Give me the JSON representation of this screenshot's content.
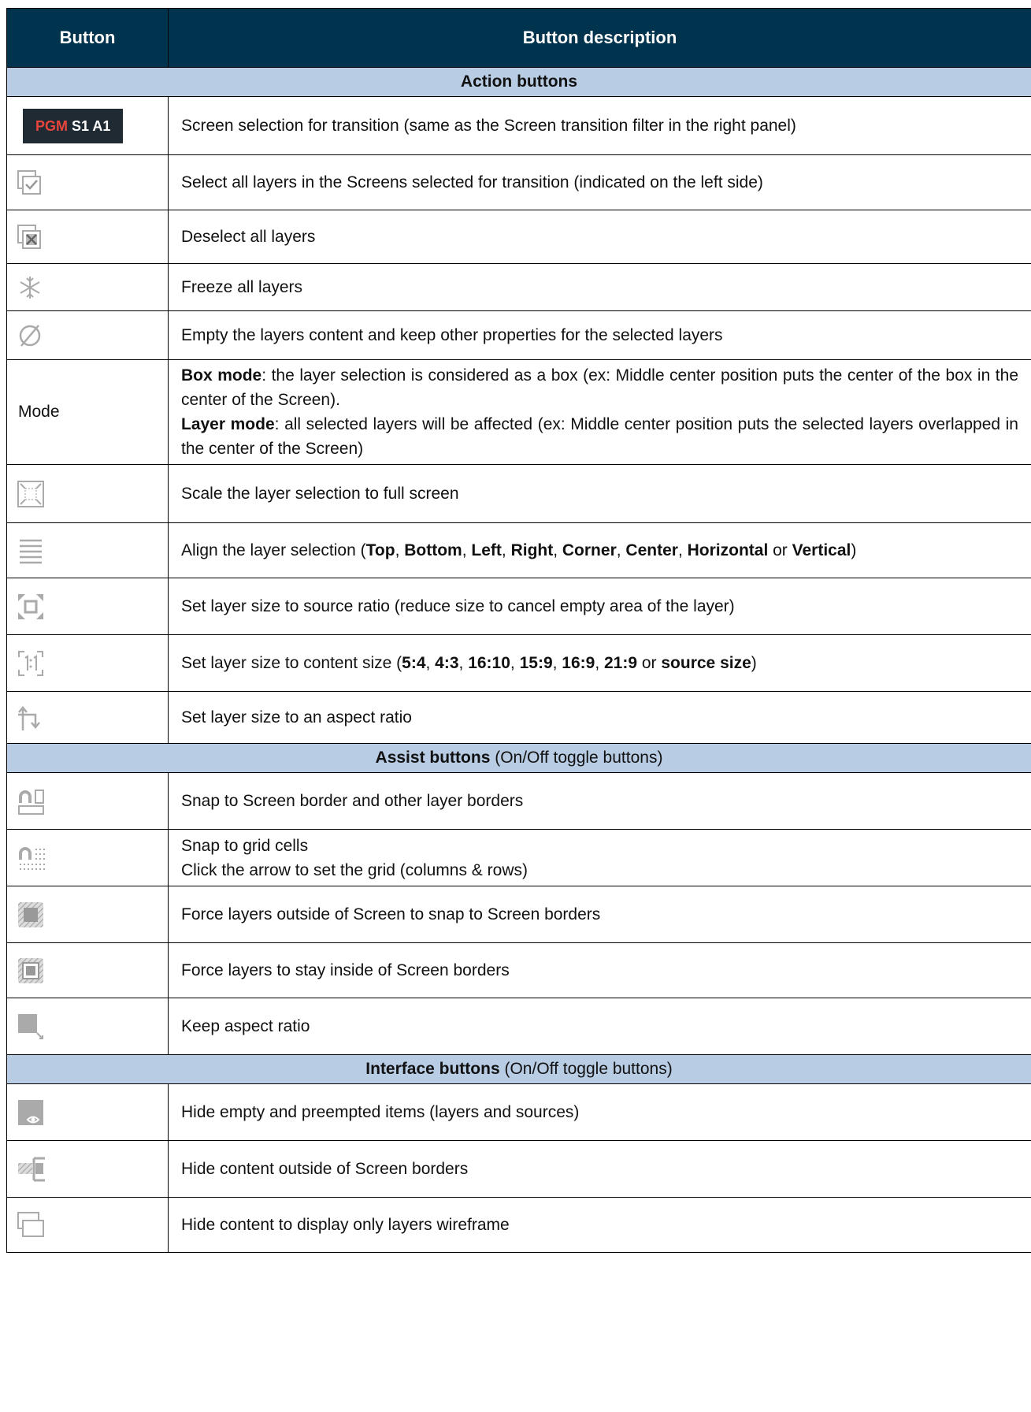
{
  "header": {
    "col_button": "Button",
    "col_description": "Button description"
  },
  "sections": {
    "action": {
      "title": "Action buttons",
      "suffix": ""
    },
    "assist": {
      "title": "Assist buttons",
      "suffix": " (On/Off toggle buttons)"
    },
    "interface": {
      "title": "Interface buttons",
      "suffix": " (On/Off toggle buttons)"
    }
  },
  "pgm_icon": {
    "pgm": "PGM",
    "s1": "S1",
    "a1": "A1"
  },
  "mode_label": "Mode",
  "rows": {
    "screen_selection": "Screen selection for transition (same as the Screen transition filter in the right panel)",
    "select_all": "Select all layers in the Screens selected for transition (indicated on the left side)",
    "deselect_all": "Deselect all layers",
    "freeze_all": "Freeze all layers",
    "empty_layers": "Empty the layers content and keep other properties for the selected layers",
    "box_mode_label": "Box mode",
    "box_mode_text": ": the layer selection is considered as a box (ex: Middle center position puts the center of the box in the center of the Screen).",
    "layer_mode_label": "Layer mode",
    "layer_mode_text": ": all selected layers will be affected (ex: Middle center position puts the selected layers overlapped in the center of the Screen)",
    "scale_full": "Scale the layer selection to full screen",
    "align_prefix": "Align the layer selection (",
    "align_opts": [
      "Top",
      "Bottom",
      "Left",
      "Right",
      "Corner",
      "Center",
      "Horizontal",
      "Vertical"
    ],
    "source_ratio": "Set layer size to source ratio (reduce size to cancel empty area of the layer)",
    "content_prefix": "Set layer size to content size (",
    "content_opts": [
      "5:4",
      "4:3",
      "16:10",
      "15:9",
      "16:9",
      "21:9",
      "source size"
    ],
    "aspect_ratio": "Set layer size to an aspect ratio",
    "snap_border": "Snap to Screen border and other layer borders",
    "snap_grid_1": "Snap to grid cells",
    "snap_grid_2": "Click the arrow to set the grid (columns & rows)",
    "force_snap": "Force layers outside of Screen to snap to Screen borders",
    "force_inside": "Force layers to stay inside of Screen borders",
    "keep_aspect": "Keep aspect ratio",
    "hide_empty": "Hide empty and preempted items (layers and sources)",
    "hide_outside": "Hide content outside of Screen borders",
    "hide_wireframe": "Hide content to display only layers wireframe"
  },
  "words": {
    "or": " or ",
    "comma": ", ",
    "close": ")"
  }
}
